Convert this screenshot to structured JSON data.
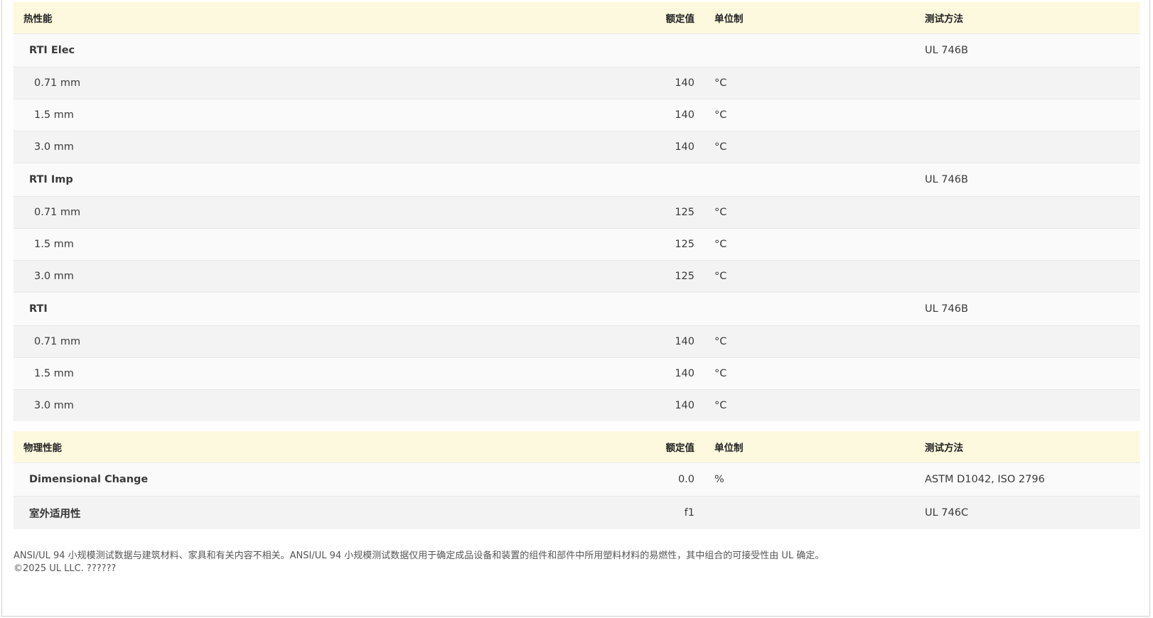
{
  "thermal": {
    "header": {
      "property": "热性能",
      "value": "额定值",
      "unit": "单位制",
      "method": "测试方法"
    },
    "rows": [
      {
        "kind": "group",
        "property": "RTI Elec",
        "value": "",
        "unit": "",
        "method": "UL 746B"
      },
      {
        "kind": "sub",
        "property": "0.71 mm",
        "value": "140",
        "unit": "°C",
        "method": ""
      },
      {
        "kind": "sub",
        "property": "1.5 mm",
        "value": "140",
        "unit": "°C",
        "method": ""
      },
      {
        "kind": "sub",
        "property": "3.0 mm",
        "value": "140",
        "unit": "°C",
        "method": ""
      },
      {
        "kind": "group",
        "property": "RTI Imp",
        "value": "",
        "unit": "",
        "method": "UL 746B"
      },
      {
        "kind": "sub",
        "property": "0.71 mm",
        "value": "125",
        "unit": "°C",
        "method": ""
      },
      {
        "kind": "sub",
        "property": "1.5 mm",
        "value": "125",
        "unit": "°C",
        "method": ""
      },
      {
        "kind": "sub",
        "property": "3.0 mm",
        "value": "125",
        "unit": "°C",
        "method": ""
      },
      {
        "kind": "group",
        "property": "RTI",
        "value": "",
        "unit": "",
        "method": "UL 746B"
      },
      {
        "kind": "sub",
        "property": "0.71 mm",
        "value": "140",
        "unit": "°C",
        "method": ""
      },
      {
        "kind": "sub",
        "property": "1.5 mm",
        "value": "140",
        "unit": "°C",
        "method": ""
      },
      {
        "kind": "sub",
        "property": "3.0 mm",
        "value": "140",
        "unit": "°C",
        "method": ""
      }
    ]
  },
  "physical": {
    "header": {
      "property": "物理性能",
      "value": "额定值",
      "unit": "单位制",
      "method": "测试方法"
    },
    "rows": [
      {
        "kind": "group",
        "property": "Dimensional Change",
        "value": "0.0",
        "unit": "%",
        "method": "ASTM D1042, ISO 2796"
      },
      {
        "kind": "group",
        "property": "室外适用性",
        "value": "f1",
        "unit": "",
        "method": "UL 746C"
      }
    ]
  },
  "footer": {
    "disclaimer": "ANSI/UL 94 小规模测试数据与建筑材料、家具和有关内容不相关。ANSI/UL 94 小规模测试数据仅用于确定成品设备和装置的组件和部件中所用塑料材料的易燃性，其中组合的可接受性由 UL 确定。",
    "copyright": "©2025 UL LLC. ??????"
  }
}
